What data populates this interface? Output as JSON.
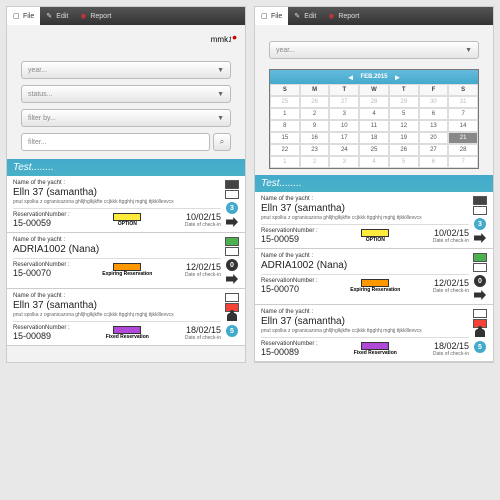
{
  "tabs": {
    "file": "File",
    "edit": "Edit",
    "report": "Report"
  },
  "logo": "mmk",
  "filters": {
    "year": "year...",
    "status": "status...",
    "filterby": "filter by...",
    "filter": "filter..."
  },
  "section": "Test........",
  "cal": {
    "month": "FEB.2015",
    "days": [
      "S",
      "M",
      "T",
      "W",
      "T",
      "F",
      "S"
    ],
    "grid": [
      [
        "25",
        "26",
        "27",
        "28",
        "29",
        "30",
        "31"
      ],
      [
        "1",
        "2",
        "3",
        "4",
        "5",
        "6",
        "7"
      ],
      [
        "8",
        "9",
        "10",
        "11",
        "12",
        "13",
        "14"
      ],
      [
        "15",
        "16",
        "17",
        "18",
        "19",
        "20",
        "21"
      ],
      [
        "22",
        "23",
        "24",
        "25",
        "26",
        "27",
        "28"
      ],
      [
        "1",
        "2",
        "3",
        "4",
        "5",
        "6",
        "7"
      ]
    ]
  },
  "labels": {
    "yacht": "Name of the yacht :",
    "res": "ReservationNumber :",
    "checkin": "Date of check-in"
  },
  "cards": [
    {
      "name": "Elln 37 (samantha)",
      "desc": "pnut spolka z ogranicazona ghlljhglkjkfte ccjkkk ttgghhj mghjj ttjkklllexvcx",
      "res": "15-00059",
      "badge": "OPTION",
      "badgeColor": "#ffeb3b",
      "date": "10/02/15",
      "sw1": "#444",
      "sw2": "#fff",
      "circle": "3",
      "circleDark": false,
      "arrow": true,
      "guest": false
    },
    {
      "name": "ADRIA1002 (Nana)",
      "desc": "",
      "res": "15-00070",
      "badge": "Expiring Reservation",
      "badgeColor": "#ff9800",
      "date": "12/02/15",
      "sw1": "#4caf50",
      "sw2": "#fff",
      "circle": "0",
      "circleDark": true,
      "arrow": true,
      "guest": false
    },
    {
      "name": "Elln 37 (samantha)",
      "desc": "pnut spolka z ogranicazona ghlljhglkjkfte ccjkkk ttgghhj mghjj ttjkklllexvcx",
      "res": "15-00089",
      "badge": "Fixed Reservation",
      "badgeColor": "#b048d8",
      "date": "18/02/15",
      "sw1": "#fff",
      "sw2": "#f44336",
      "circle": "5",
      "circleDark": false,
      "arrow": false,
      "guest": true
    }
  ]
}
